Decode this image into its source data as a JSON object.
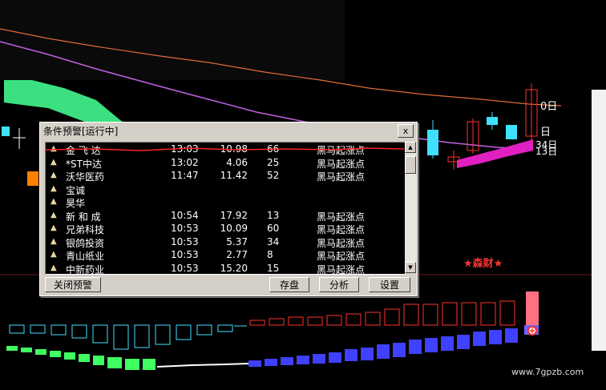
{
  "dialog": {
    "title": "条件预警[运行中]",
    "close_symbol": "x",
    "rows": [
      {
        "icon": "▲",
        "name": "金 飞 达",
        "time": "13:03",
        "price": "10.98",
        "vol": "66",
        "signal": "黑马起涨点"
      },
      {
        "icon": "▲",
        "name": "*ST中达",
        "time": "13:02",
        "price": "4.06",
        "vol": "25",
        "signal": "黑马起涨点"
      },
      {
        "icon": "▲",
        "name": "沃华医药",
        "time": "11:47",
        "price": "11.42",
        "vol": "52",
        "signal": "黑马起涨点"
      },
      {
        "icon": "▲",
        "name": "宝诚",
        "time": "",
        "price": "",
        "vol": "",
        "signal": ""
      },
      {
        "icon": "▲",
        "name": "昊华",
        "time": "",
        "price": "",
        "vol": "",
        "signal": ""
      },
      {
        "icon": "▲",
        "name": "新 和 成",
        "time": "10:54",
        "price": "17.92",
        "vol": "13",
        "signal": "黑马起涨点"
      },
      {
        "icon": "▲",
        "name": "兄弟科技",
        "time": "10:53",
        "price": "10.09",
        "vol": "60",
        "signal": "黑马起涨点"
      },
      {
        "icon": "▲",
        "name": "银鸽投资",
        "time": "10:53",
        "price": "5.37",
        "vol": "34",
        "signal": "黑马起涨点"
      },
      {
        "icon": "▲",
        "name": "青山纸业",
        "time": "10:53",
        "price": "2.77",
        "vol": "8",
        "signal": "黑马起涨点"
      },
      {
        "icon": "▲",
        "name": "中新药业",
        "time": "10:53",
        "price": "15.20",
        "vol": "15",
        "signal": "黑马起涨点"
      }
    ],
    "buttons": {
      "close_alert": "关闭预警",
      "save": "存盘",
      "analyze": "分析",
      "settings": "设置"
    }
  },
  "chart": {
    "side_labels": [
      "0日",
      "日",
      "34日",
      "13日"
    ],
    "star_label": "★森财★",
    "watermark": "www.7gpzb.com",
    "colors": {
      "orange_line": "#e06a3a",
      "purple_line": "#c060e0",
      "green_band": "#3ce080",
      "magenta_band": "#e020c0",
      "cyan_candle": "#40e0ff",
      "red_bar": "#ff3030",
      "green_bar": "#40ff60",
      "blue_bar": "#4040ff"
    }
  }
}
